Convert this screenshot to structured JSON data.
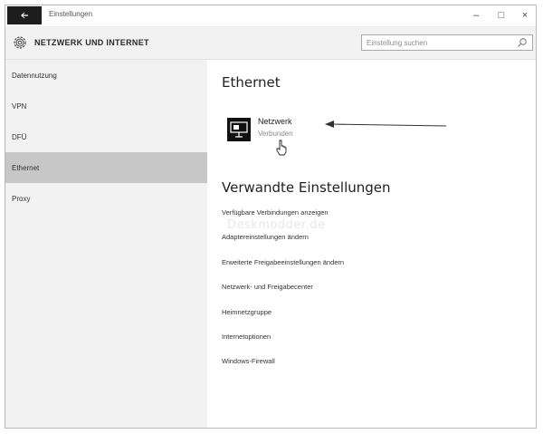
{
  "window": {
    "title": "Einstellungen",
    "controls": {
      "minimize": "–",
      "maximize": "□",
      "close": "×"
    }
  },
  "header": {
    "title": "NETZWERK UND INTERNET",
    "search_placeholder": "Einstellung suchen"
  },
  "sidebar": {
    "items": [
      {
        "label": "Datennutzung",
        "active": false
      },
      {
        "label": "VPN",
        "active": false
      },
      {
        "label": "DFÜ",
        "active": false
      },
      {
        "label": "Ethernet",
        "active": true
      },
      {
        "label": "Proxy",
        "active": false
      }
    ]
  },
  "main": {
    "section_title": "Ethernet",
    "network": {
      "name": "Netzwerk",
      "status": "Verbunden"
    },
    "related_title": "Verwandte Einstellungen",
    "related_links": [
      "Verfügbare Verbindungen anzeigen",
      "Adaptereinstellungen ändern",
      "Erweiterte Freigabeeinstellungen ändern",
      "Netzwerk- und Freigabecenter",
      "Heimnetzgruppe",
      "Internetoptionen",
      "Windows-Firewall"
    ],
    "watermark": "Deskmodder.de"
  },
  "colors": {
    "sidebar_bg": "#f2f2f2",
    "active_item_bg": "#c7c7c7",
    "back_button_bg": "#1d1d1d"
  },
  "icons": {
    "back": "back-arrow-icon",
    "settings": "gear-icon",
    "search": "search-icon",
    "network": "ethernet-network-icon",
    "cursor": "hand-cursor-icon",
    "annotation": "annotation-arrow-icon"
  }
}
